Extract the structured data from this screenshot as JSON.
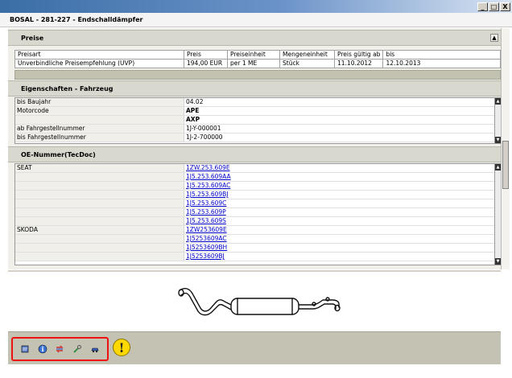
{
  "window": {
    "title": "BOSAL - 281-227 - Endschalldämpfer",
    "controls": {
      "minimize": "_",
      "maximize": "□",
      "close": "X"
    }
  },
  "sections": {
    "prices": {
      "title": "Preise",
      "columns": [
        "Preisart",
        "Preis",
        "Preiseinheit",
        "Mengeneinheit",
        "Preis gültig ab",
        "bis"
      ],
      "rows": [
        [
          "Unverbindliche Preisempfehlung (UVP)",
          "194,00 EUR",
          "per 1 ME",
          "Stück",
          "11.10.2012",
          "12.10.2013"
        ]
      ]
    },
    "vehicle": {
      "title": "Eigenschaften - Fahrzeug",
      "rows": [
        {
          "label": "bis Baujahr",
          "value": "04.02",
          "bold": false
        },
        {
          "label": "Motorcode",
          "value": "APE",
          "bold": true
        },
        {
          "label": "",
          "value": "AXP",
          "bold": true
        },
        {
          "label": "ab Fahrgestellnummer",
          "value": "1J-Y-000001",
          "bold": false
        },
        {
          "label": "bis Fahrgestellnummer",
          "value": "1J-2-700000",
          "bold": false
        }
      ]
    },
    "oe": {
      "title": "OE-Nummer(TecDoc)",
      "rows": [
        {
          "label": "SEAT",
          "value": "1ZW.253.609E"
        },
        {
          "label": "",
          "value": "1J5.253.609AA"
        },
        {
          "label": "",
          "value": "1J5.253.609AC"
        },
        {
          "label": "",
          "value": "1J5.253.609BJ"
        },
        {
          "label": "",
          "value": "1J5.253.609C"
        },
        {
          "label": "",
          "value": "1J5.253.609P"
        },
        {
          "label": "",
          "value": "1J5.253.609S"
        },
        {
          "label": "SKODA",
          "value": "1ZW253609E"
        },
        {
          "label": "",
          "value": "1J5253609AC"
        },
        {
          "label": "",
          "value": "1J5253609BH"
        },
        {
          "label": "",
          "value": "1J5253609BJ"
        }
      ]
    }
  },
  "toolbar": {
    "icons": [
      "note-icon",
      "info-icon",
      "refresh-icon",
      "tools-icon",
      "car-icon"
    ],
    "warning_symbol": "!"
  },
  "colors": {
    "accent_title": "#3a6ea5",
    "toolbar_bg": "#c4c2b2",
    "highlight_border": "#e11",
    "link": "#0000cc",
    "warning": "#ffd800"
  }
}
